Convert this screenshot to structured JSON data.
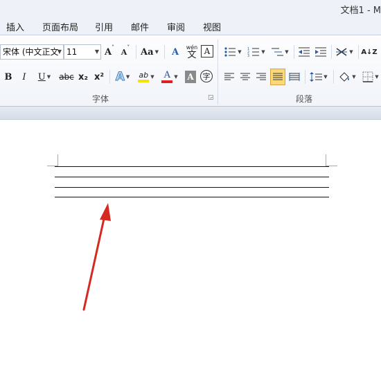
{
  "window": {
    "title": "文档1 - M"
  },
  "tabs": [
    {
      "label": "插入"
    },
    {
      "label": "页面布局"
    },
    {
      "label": "引用"
    },
    {
      "label": "邮件"
    },
    {
      "label": "审阅"
    },
    {
      "label": "视图"
    }
  ],
  "font_group": {
    "label": "字体",
    "font_name": "宋体 (中文正文",
    "font_size": "11",
    "grow": "A",
    "shrink": "A",
    "change_case": "Aa",
    "clear_format": "A",
    "phonetic": "wén",
    "enclose": "A",
    "bold": "B",
    "italic": "I",
    "underline": "U",
    "strike": "abc",
    "subscript": "x₂",
    "superscript": "x²",
    "text_effects": "A",
    "highlight": "ab",
    "font_color": "A",
    "char_shading": "A",
    "enclose_char": "字"
  },
  "paragraph_group": {
    "label": "段落"
  },
  "sort_label": "A↓Z",
  "colors": {
    "arrow": "#d42a22",
    "highlight_active": "#fbd87a"
  },
  "watermark": ""
}
